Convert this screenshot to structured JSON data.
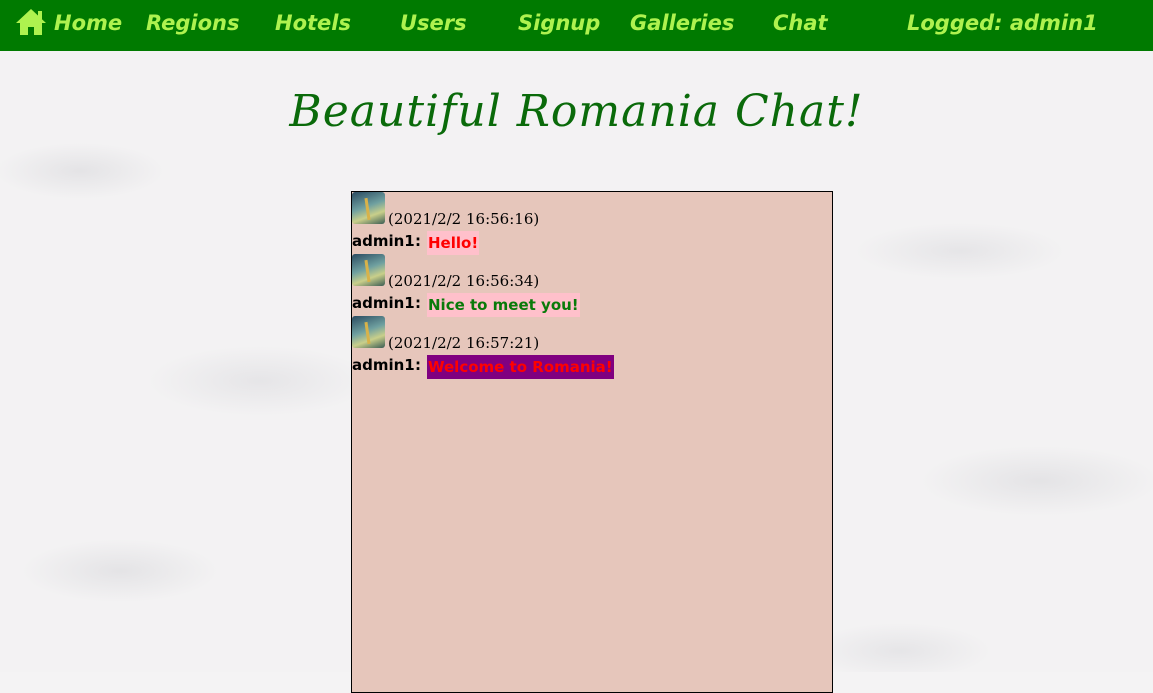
{
  "nav": {
    "home": "Home",
    "regions": "Regions",
    "hotels": "Hotels",
    "users": "Users",
    "signup": "Signup",
    "galleries": "Galleries",
    "chat": "Chat",
    "logged_in": "Logged: admin1"
  },
  "page_title": "Beautiful Romania Chat!",
  "messages": [
    {
      "timestamp": "(2021/2/2 16:56:16)",
      "sender": "admin1",
      "separator": ":",
      "text": "Hello!",
      "text_color": "#ff0000",
      "bg_color": "#ffc0cb"
    },
    {
      "timestamp": "(2021/2/2 16:56:34)",
      "sender": "admin1",
      "separator": ":",
      "text": "Nice to meet you!",
      "text_color": "#0a7a0a",
      "bg_color": "#ffc0cb"
    },
    {
      "timestamp": "(2021/2/2 16:57:21)",
      "sender": "admin1",
      "separator": ":",
      "text": "Welcome to Romania!",
      "text_color": "#ff0000",
      "bg_color": "#800080"
    }
  ],
  "colors": {
    "navbar": "#007a00",
    "nav_text": "#aef24f",
    "title": "#0a6a0a",
    "chat_bg": "#e6c6bb"
  }
}
